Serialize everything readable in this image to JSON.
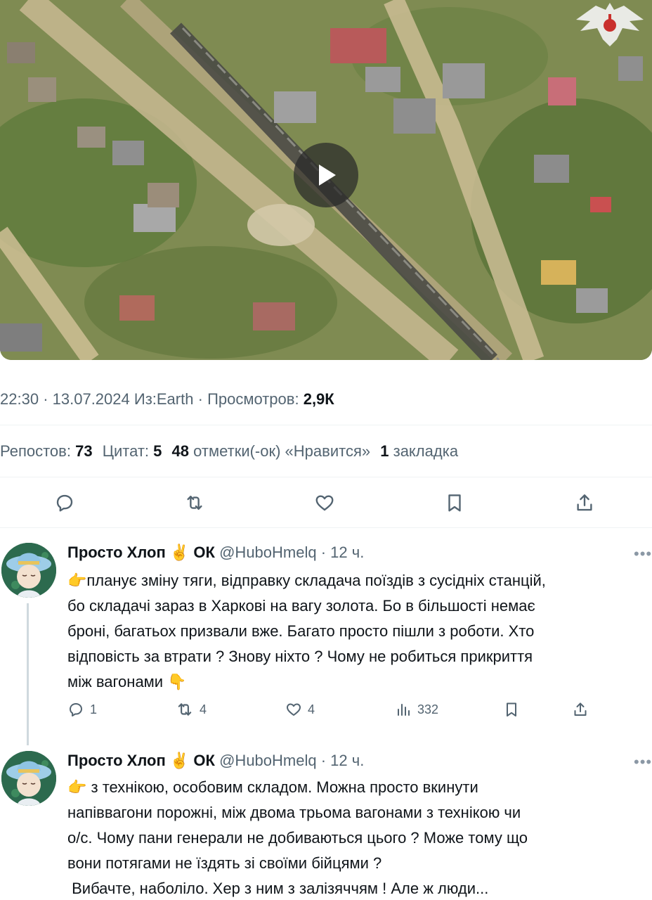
{
  "media": {
    "type": "video",
    "play_icon": "play-icon",
    "watermark_icon": "double-headed-eagle-emblem"
  },
  "meta": {
    "time": "22:30",
    "date": "13.07.2024",
    "source": "Из:Earth",
    "views_label": "Просмотров:",
    "views_value": "2,9К"
  },
  "stats": {
    "reposts_label": "Репостов:",
    "reposts_value": "73",
    "quotes_label": "Цитат:",
    "quotes_value": "5",
    "likes_value": "48",
    "likes_label": "отметки(-ок) «Нравится»",
    "bookmarks_value": "1",
    "bookmarks_label": "закладка"
  },
  "actions": {
    "reply_icon": "reply-icon",
    "repost_icon": "repost-icon",
    "like_icon": "heart-icon",
    "bookmark_icon": "bookmark-icon",
    "share_icon": "share-icon"
  },
  "replies": [
    {
      "name": "Просто Хлоп",
      "name_emoji": "✌️",
      "name_suffix": "ОК",
      "handle": "@HuboHmelq",
      "time": "· 12 ч.",
      "lines": [
        "👉планує зміну тяги, відправку складача поїздів з сусідніх станцій,",
        "бо складачі зараз в Харкові на вагу золота. Бо в більшості немає",
        "броні, багатьох призвали вже. Багато просто пішли з роботи. Хто",
        "відповість за втрати ? Знову ніхто ? Чому не робиться прикриття",
        "між вагонами 👇"
      ],
      "reply_count": "1",
      "repost_count": "4",
      "like_count": "4",
      "view_count": "332"
    },
    {
      "name": "Просто Хлоп",
      "name_emoji": "✌️",
      "name_suffix": "ОК",
      "handle": "@HuboHmelq",
      "time": "· 12 ч.",
      "lines": [
        "👉 з технікою, особовим складом. Можна просто вкинути",
        "напіввагони порожні, між двома трьома вагонами з технікою чи",
        "о/с. Чому пани генерали не добиваються цього ? Може тому що",
        "вони потягами не їздять зі своїми бійцями ?",
        " Вибачте, наболіло. Хер з ним з залізяччям ! Але ж люди..."
      ]
    }
  ]
}
